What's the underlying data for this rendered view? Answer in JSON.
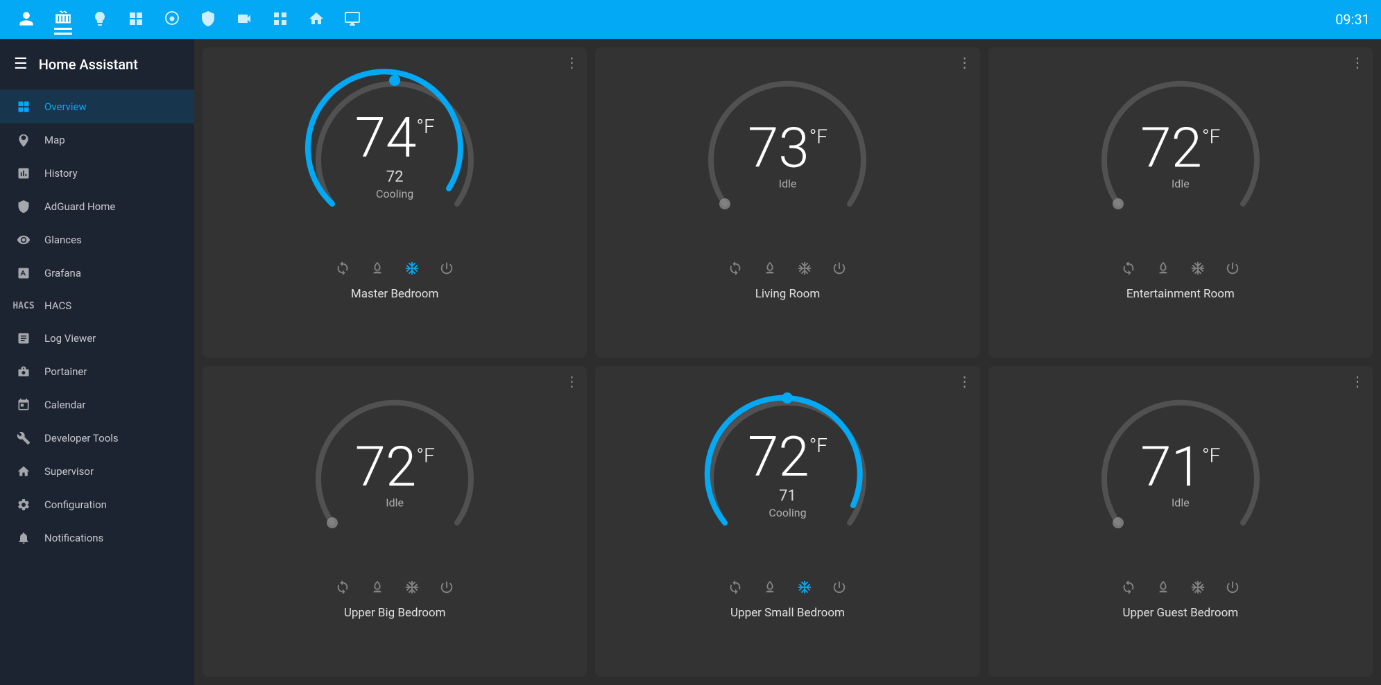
{
  "app": {
    "title": "Home Assistant",
    "time": "09:31"
  },
  "topbar": {
    "icons": [
      {
        "name": "person-icon",
        "symbol": "👤",
        "active": false
      },
      {
        "name": "radiator-icon",
        "symbol": "♨",
        "active": true
      },
      {
        "name": "lightbulb-icon",
        "symbol": "💡",
        "active": false
      },
      {
        "name": "panel-icon",
        "symbol": "▣",
        "active": false
      },
      {
        "name": "camera-face-icon",
        "symbol": "◎",
        "active": false
      },
      {
        "name": "shield-icon",
        "symbol": "⛨",
        "active": false
      },
      {
        "name": "video-icon",
        "symbol": "▶",
        "active": false
      },
      {
        "name": "grid-icon",
        "symbol": "⊞",
        "active": false
      },
      {
        "name": "home-icon",
        "symbol": "⌂",
        "active": false
      },
      {
        "name": "monitor-icon",
        "symbol": "▭",
        "active": false
      }
    ]
  },
  "sidebar": {
    "menu_icon": "≡",
    "title": "Home Assistant",
    "items": [
      {
        "id": "overview",
        "label": "Overview",
        "icon": "⊞",
        "active": true
      },
      {
        "id": "map",
        "label": "Map",
        "icon": "👤",
        "active": false
      },
      {
        "id": "history",
        "label": "History",
        "icon": "📊",
        "active": false
      },
      {
        "id": "adguard",
        "label": "AdGuard Home",
        "icon": "🛡",
        "active": false
      },
      {
        "id": "glances",
        "label": "Glances",
        "icon": "◑",
        "active": false
      },
      {
        "id": "grafana",
        "label": "Grafana",
        "icon": "▤",
        "active": false
      },
      {
        "id": "hacs",
        "label": "HACS",
        "icon": "H",
        "active": false
      },
      {
        "id": "logviewer",
        "label": "Log Viewer",
        "icon": "▤",
        "active": false
      },
      {
        "id": "portainer",
        "label": "Portainer",
        "icon": "⚓",
        "active": false
      },
      {
        "id": "calendar",
        "label": "Calendar",
        "icon": "📅",
        "active": false
      },
      {
        "id": "devtools",
        "label": "Developer Tools",
        "icon": "🔧",
        "active": false
      },
      {
        "id": "supervisor",
        "label": "Supervisor",
        "icon": "⌂",
        "active": false
      },
      {
        "id": "configuration",
        "label": "Configuration",
        "icon": "⚙",
        "active": false
      },
      {
        "id": "notifications",
        "label": "Notifications",
        "icon": "🔔",
        "active": false
      }
    ]
  },
  "thermostats": [
    {
      "id": "master-bedroom",
      "name": "Master Bedroom",
      "temp": "74",
      "unit": "°F",
      "setpoint": "72",
      "status": "Cooling",
      "status_code": "cooling",
      "arc_active": true,
      "arc_start_angle": 140,
      "arc_end_angle": 320
    },
    {
      "id": "living-room",
      "name": "Living Room",
      "temp": "73",
      "unit": "°F",
      "setpoint": "",
      "status": "Idle",
      "status_code": "idle",
      "arc_active": false,
      "arc_start_angle": 140,
      "arc_end_angle": 140
    },
    {
      "id": "entertainment-room",
      "name": "Entertainment Room",
      "temp": "72",
      "unit": "°F",
      "setpoint": "",
      "status": "Idle",
      "status_code": "idle",
      "arc_active": false,
      "arc_start_angle": 140,
      "arc_end_angle": 140
    },
    {
      "id": "upper-big-bedroom",
      "name": "Upper Big Bedroom",
      "temp": "72",
      "unit": "°F",
      "setpoint": "",
      "status": "Idle",
      "status_code": "idle",
      "arc_active": false,
      "arc_start_angle": 140,
      "arc_end_angle": 140
    },
    {
      "id": "upper-small-bedroom",
      "name": "Upper Small Bedroom",
      "temp": "72",
      "unit": "°F",
      "setpoint": "71",
      "status": "Cooling",
      "status_code": "cooling",
      "arc_active": true,
      "arc_start_angle": 140,
      "arc_end_angle": 330
    },
    {
      "id": "upper-guest-bedroom",
      "name": "Upper Guest Bedroom",
      "temp": "71",
      "unit": "°F",
      "setpoint": "",
      "status": "Idle",
      "status_code": "idle",
      "arc_active": false,
      "arc_start_angle": 140,
      "arc_end_angle": 140
    }
  ]
}
